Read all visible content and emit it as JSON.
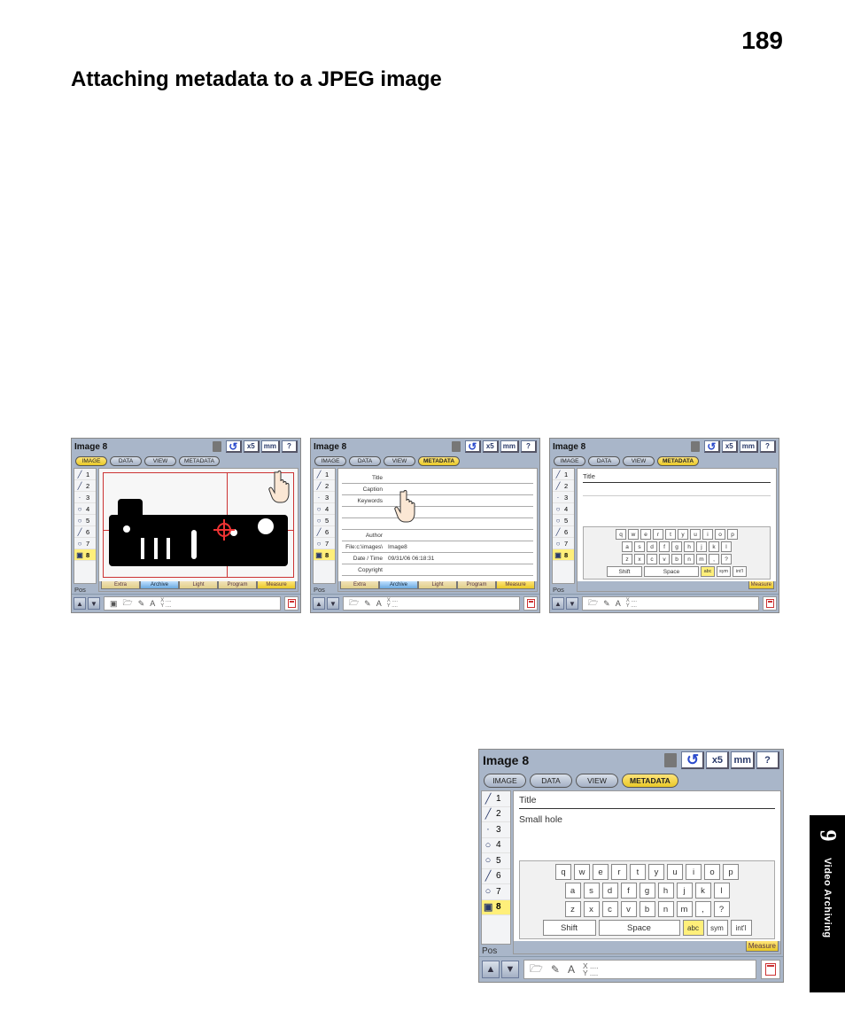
{
  "page_number": "189",
  "heading": "Attaching metadata to a JPEG image",
  "side_tab": {
    "number": "9",
    "label": "Video Archiving"
  },
  "shared": {
    "title": "Image 8",
    "top_buttons": {
      "swirl": "↺",
      "x5": "x5",
      "mm": "mm",
      "help": "?"
    },
    "tabs": {
      "image": "IMAGE",
      "data": "DATA",
      "view": "VIEW",
      "metadata": "METADATA"
    },
    "sidebar_items": [
      {
        "icon": "╱",
        "n": "1"
      },
      {
        "icon": "╱",
        "n": "2"
      },
      {
        "icon": "·",
        "n": "3"
      },
      {
        "icon": "○",
        "n": "4"
      },
      {
        "icon": "○",
        "n": "5"
      },
      {
        "icon": "╱",
        "n": "6"
      },
      {
        "icon": "○",
        "n": "7"
      },
      {
        "icon": "▣",
        "n": "8"
      }
    ],
    "pos_label": "Pos",
    "bottom_strip": {
      "extra": "Extra",
      "archive": "Archive",
      "light": "Light",
      "program": "Program",
      "measure": "Measure"
    },
    "tools": {
      "cam": "▣",
      "open": "🗁",
      "pen": "✎",
      "A": "A",
      "xy_x": "X ....",
      "xy_y": "Y ...."
    }
  },
  "panel2_form": [
    {
      "label": "Title",
      "value": ""
    },
    {
      "label": "Caption",
      "value": ""
    },
    {
      "label": "Keywords",
      "value": ""
    },
    {
      "label": "",
      "value": ""
    },
    {
      "label": "",
      "value": ""
    },
    {
      "label": "Author",
      "value": ""
    },
    {
      "label": "File:c:\\images\\",
      "value": "Image8"
    },
    {
      "label": "Date / Time",
      "value": "09/31/06 06:18:31"
    },
    {
      "label": "Copyright",
      "value": ""
    }
  ],
  "panel3": {
    "title_label": "Title"
  },
  "panel4": {
    "title_label": "Title",
    "note": "Small hole"
  },
  "keyboard": {
    "row1": [
      "q",
      "w",
      "e",
      "r",
      "t",
      "y",
      "u",
      "i",
      "o",
      "p"
    ],
    "row2": [
      "a",
      "s",
      "d",
      "f",
      "g",
      "h",
      "j",
      "k",
      "l"
    ],
    "row3": [
      "z",
      "x",
      "c",
      "v",
      "b",
      "n",
      "m",
      ",",
      "?"
    ],
    "row4_shift": "Shift",
    "row4_space": "Space",
    "row4_mode": [
      "abc",
      "sym",
      "int'l"
    ]
  }
}
